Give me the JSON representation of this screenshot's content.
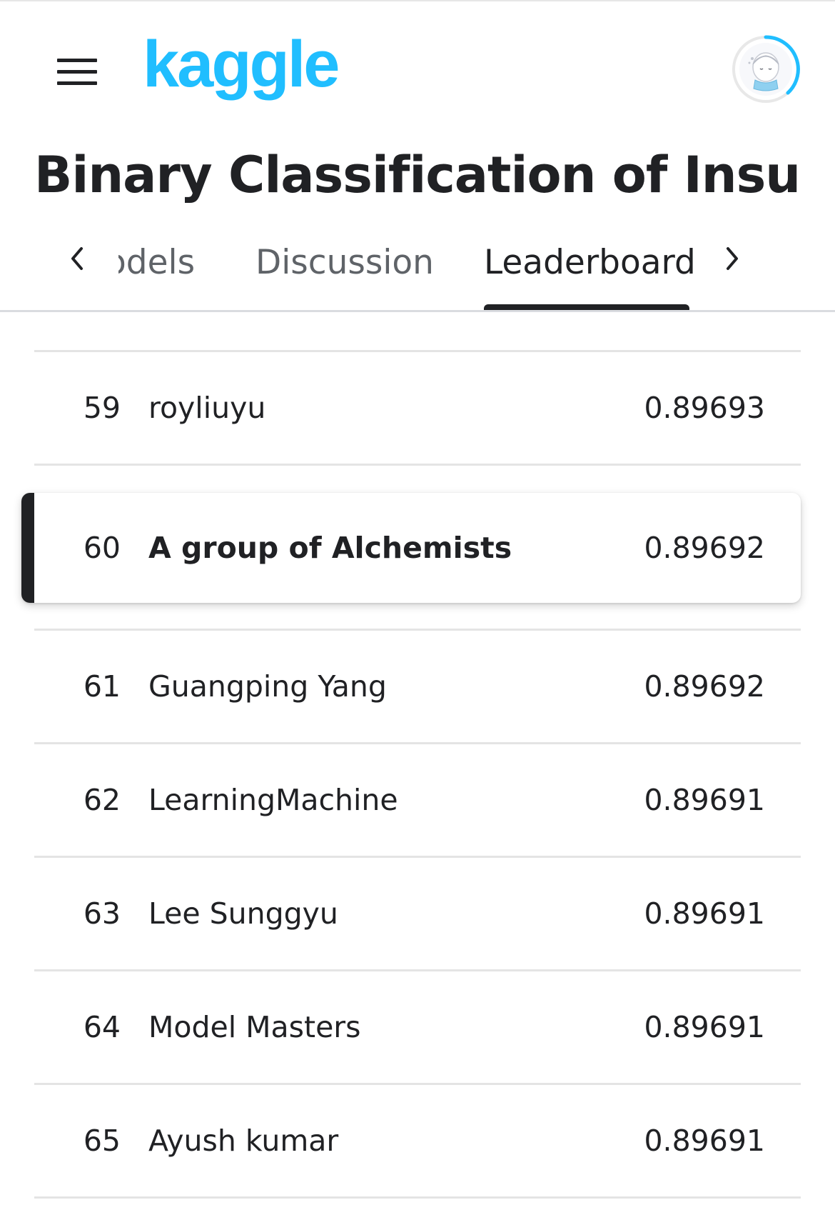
{
  "header": {
    "logo_text": "kaggle",
    "logo_color": "#20beff",
    "menu_icon": "hamburger-menu-icon",
    "avatar_icon": "user-avatar"
  },
  "page": {
    "title": "Binary Classification of Insurar"
  },
  "tabs": {
    "items": [
      {
        "label": "odels"
      },
      {
        "label": "Discussion"
      },
      {
        "label": "Leaderboard"
      }
    ],
    "active": "Leaderboard",
    "prev_icon": "chevron-left-icon",
    "next_icon": "chevron-right-icon"
  },
  "leaderboard": {
    "rows": [
      {
        "rank": "59",
        "team": "royliuyu",
        "score": "0.89693"
      },
      {
        "rank": "60",
        "team": "A group of Alchemists",
        "score": "0.89692",
        "highlighted": true
      },
      {
        "rank": "61",
        "team": "Guangping Yang",
        "score": "0.89692"
      },
      {
        "rank": "62",
        "team": "LearningMachine",
        "score": "0.89691"
      },
      {
        "rank": "63",
        "team": "Lee Sunggyu",
        "score": "0.89691"
      },
      {
        "rank": "64",
        "team": "Model Masters",
        "score": "0.89691"
      },
      {
        "rank": "65",
        "team": "Ayush kumar",
        "score": "0.89691"
      }
    ]
  }
}
